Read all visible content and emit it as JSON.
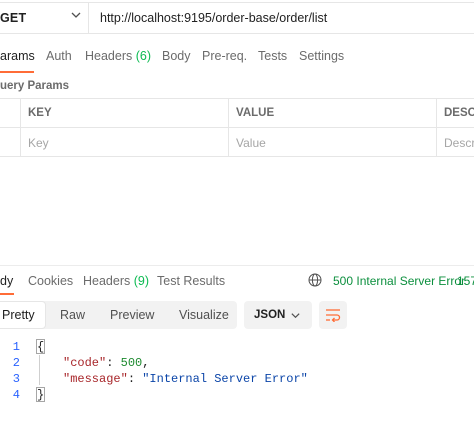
{
  "request": {
    "method": "GET",
    "url": "http://localhost:9195/order-base/order/list"
  },
  "request_tabs": [
    {
      "label": "arams",
      "active": true
    },
    {
      "label": "Auth"
    },
    {
      "label": "Headers",
      "count": "(6)"
    },
    {
      "label": "Body"
    },
    {
      "label": "Pre-req."
    },
    {
      "label": "Tests"
    },
    {
      "label": "Settings"
    }
  ],
  "params": {
    "section_label": "uery Params",
    "headers": {
      "key": "KEY",
      "value": "VALUE",
      "desc": "DESC"
    },
    "placeholders": {
      "key": "Key",
      "value": "Value",
      "desc": "Descr"
    }
  },
  "response_tabs": [
    {
      "label": "dy",
      "active": true
    },
    {
      "label": "Cookies"
    },
    {
      "label": "Headers",
      "count": "(9)"
    },
    {
      "label": "Test Results"
    }
  ],
  "response_status": {
    "status": "500 Internal Server Error",
    "time": "157"
  },
  "view_modes": [
    "Pretty",
    "Raw",
    "Preview",
    "Visualize"
  ],
  "language": "JSON",
  "code": {
    "line_numbers": [
      "1",
      "2",
      "3",
      "4"
    ],
    "code_key": "\"code\"",
    "code_value": "500",
    "message_key": "\"message\"",
    "message_value": "\"Internal Server Error\""
  },
  "colors": {
    "accent": "#ff6c37",
    "count": "#0cbb52",
    "status": "#0c8f3e"
  }
}
